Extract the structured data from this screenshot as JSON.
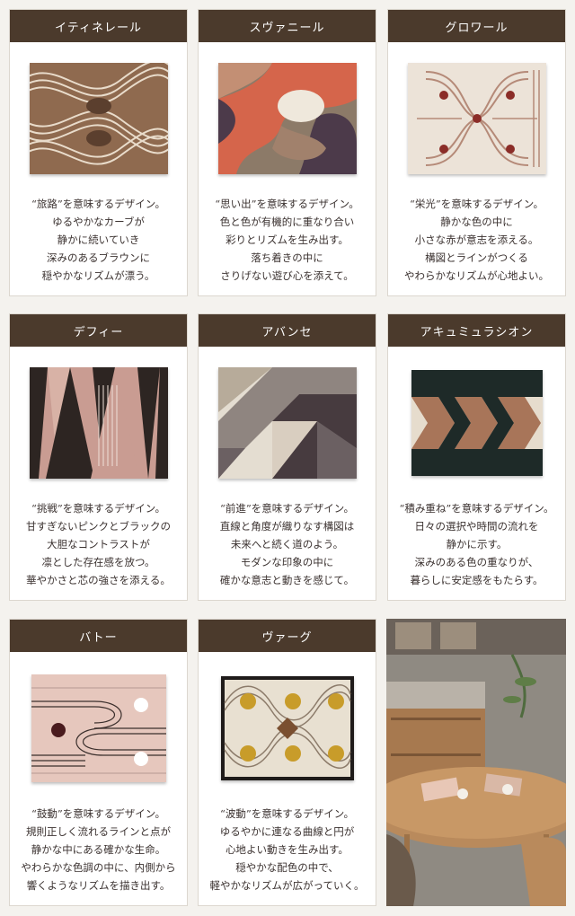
{
  "products": [
    {
      "name": "イティネレール",
      "desc": [
        "“旅路”を意味するデザイン。",
        "ゆるやかなカーブが",
        "静かに続いていき",
        "深みのあるブラウンに",
        "穏やかなリズムが漂う。"
      ]
    },
    {
      "name": "スヴァニール",
      "desc": [
        "“思い出”を意味するデザイン。",
        "色と色が有機的に重なり合い",
        "彩りとリズムを生み出す。",
        "落ち着きの中に",
        "さりげない遊び心を添えて。"
      ]
    },
    {
      "name": "グロワール",
      "desc": [
        "“栄光”を意味するデザイン。",
        "静かな色の中に",
        "小さな赤が意志を添える。",
        "構図とラインがつくる",
        "やわらかなリズムが心地よい。"
      ]
    },
    {
      "name": "デフィー",
      "desc": [
        "“挑戦”を意味するデザイン。",
        "甘すぎないピンクとブラックの",
        "大胆なコントラストが",
        "凛とした存在感を放つ。",
        "華やかさと芯の強さを添える。"
      ]
    },
    {
      "name": "アバンセ",
      "desc": [
        "“前進”を意味するデザイン。",
        "直線と角度が織りなす構図は",
        "未来へと続く道のよう。",
        "モダンな印象の中に",
        "確かな意志と動きを感じて。"
      ]
    },
    {
      "name": "アキュミュラシオン",
      "desc": [
        "“積み重ね”を意味するデザイン。",
        "日々の選択や時間の流れを",
        "静かに示す。",
        "深みのある色の重なりが、",
        "暮らしに安定感をもたらす。"
      ]
    },
    {
      "name": "バトー",
      "desc": [
        "“鼓動”を意味するデザイン。",
        "規則正しく流れるラインと点が",
        "静かな中にある確かな生命。",
        "やわらかな色調の中に、内側から",
        "響くようなリズムを描き出す。"
      ]
    },
    {
      "name": "ヴァーグ",
      "desc": [
        "“波動”を意味するデザイン。",
        "ゆるやかに連なる曲線と円が",
        "心地よい動きを生み出す。",
        "穏やかな配色の中で、",
        "軽やかなリズムが広がっていく。"
      ]
    }
  ],
  "colors": {
    "header": "#4b3a2c",
    "card_border": "#dcd7cf"
  }
}
